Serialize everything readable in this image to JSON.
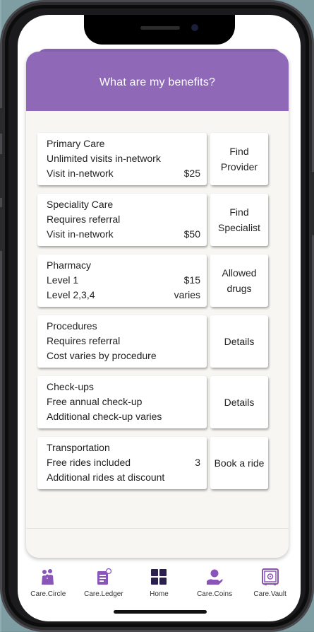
{
  "header": {
    "title": "What are my benefits?"
  },
  "benefits": [
    {
      "lines": [
        {
          "left": "Primary Care",
          "right": ""
        },
        {
          "left": "Unlimited visits in-network",
          "right": ""
        },
        {
          "left": "Visit in-network",
          "right": "$25"
        }
      ],
      "action": [
        "Find",
        "Provider"
      ]
    },
    {
      "lines": [
        {
          "left": "Speciality Care",
          "right": ""
        },
        {
          "left": "Requires referral",
          "right": ""
        },
        {
          "left": "Visit in-network",
          "right": "$50"
        }
      ],
      "action": [
        "Find",
        "Specialist"
      ]
    },
    {
      "lines": [
        {
          "left": "Pharmacy",
          "right": ""
        },
        {
          "left": "Level 1",
          "right": "$15"
        },
        {
          "left": "Level 2,3,4",
          "right": "varies"
        }
      ],
      "action": [
        "Allowed",
        "drugs"
      ]
    },
    {
      "lines": [
        {
          "left": "Procedures",
          "right": ""
        },
        {
          "left": "Requires referral",
          "right": ""
        },
        {
          "left": "Cost varies by procedure",
          "right": ""
        }
      ],
      "action": [
        "Details"
      ]
    },
    {
      "lines": [
        {
          "left": "Check-ups",
          "right": ""
        },
        {
          "left": "Free annual check-up",
          "right": ""
        },
        {
          "left": "Additional check-up varies",
          "right": ""
        }
      ],
      "action": [
        "Details"
      ]
    },
    {
      "lines": [
        {
          "left": "Transportation",
          "right": ""
        },
        {
          "left": "Free rides included",
          "right": "3"
        },
        {
          "left": "Additional rides at discount",
          "right": ""
        }
      ],
      "action": [
        "Book a ride"
      ]
    }
  ],
  "tabs": [
    {
      "label": "Care.Circle",
      "icon": "people-icon"
    },
    {
      "label": "Care.Ledger",
      "icon": "ledger-icon"
    },
    {
      "label": "Home",
      "icon": "home-grid-icon"
    },
    {
      "label": "Care.Coins",
      "icon": "coins-hand-icon"
    },
    {
      "label": "Care.Vault",
      "icon": "vault-icon"
    }
  ],
  "colors": {
    "accent": "#9068b8",
    "tab_icon": "#8a55b8",
    "home_icon": "#2a1f4f"
  }
}
